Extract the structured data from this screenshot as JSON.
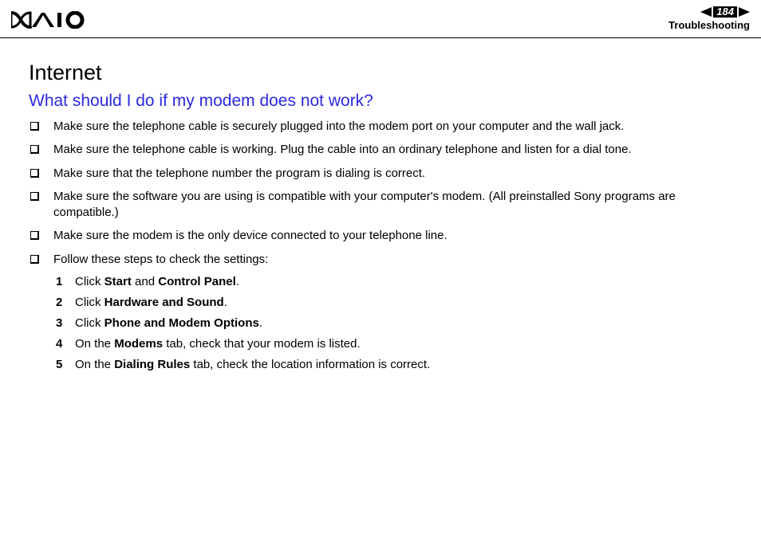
{
  "header": {
    "page_number": "184",
    "section": "Troubleshooting"
  },
  "content": {
    "title": "Internet",
    "question": "What should I do if my modem does not work?",
    "bullets": [
      "Make sure the telephone cable is securely plugged into the modem port on your computer and the wall jack.",
      "Make sure the telephone cable is working. Plug the cable into an ordinary telephone and listen for a dial tone.",
      "Make sure that the telephone number the program is dialing is correct.",
      "Make sure the software you are using is compatible with your computer's modem. (All preinstalled Sony programs are compatible.)",
      "Make sure the modem is the only device connected to your telephone line.",
      "Follow these steps to check the settings:"
    ],
    "steps": [
      {
        "num": "1",
        "pre": "Click ",
        "b1": "Start",
        "mid": " and ",
        "b2": "Control Panel",
        "post": "."
      },
      {
        "num": "2",
        "pre": "Click ",
        "b1": "Hardware and Sound",
        "mid": "",
        "b2": "",
        "post": "."
      },
      {
        "num": "3",
        "pre": "Click ",
        "b1": "Phone and Modem Options",
        "mid": "",
        "b2": "",
        "post": "."
      },
      {
        "num": "4",
        "pre": "On the ",
        "b1": "Modems",
        "mid": " tab, check that your modem is listed.",
        "b2": "",
        "post": ""
      },
      {
        "num": "5",
        "pre": "On the ",
        "b1": "Dialing Rules",
        "mid": " tab, check the location information is correct.",
        "b2": "",
        "post": ""
      }
    ]
  }
}
